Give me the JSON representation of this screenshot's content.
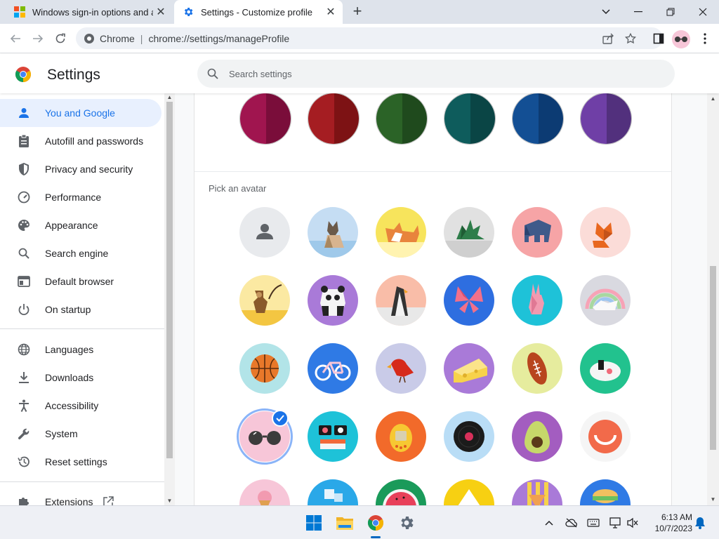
{
  "browser": {
    "tabs": [
      {
        "title": "Windows sign-in options and acc",
        "active": false
      },
      {
        "title": "Settings - Customize profile",
        "active": true
      }
    ],
    "omnibox": {
      "chip": "Chrome",
      "url": "chrome://settings/manageProfile"
    }
  },
  "settings": {
    "title": "Settings",
    "search_placeholder": "Search settings",
    "nav": [
      {
        "label": "You and Google",
        "icon": "person-icon",
        "active": true
      },
      {
        "label": "Autofill and passwords",
        "icon": "clipboard-icon"
      },
      {
        "label": "Privacy and security",
        "icon": "shield-icon"
      },
      {
        "label": "Performance",
        "icon": "speedometer-icon"
      },
      {
        "label": "Appearance",
        "icon": "palette-icon"
      },
      {
        "label": "Search engine",
        "icon": "search-icon"
      },
      {
        "label": "Default browser",
        "icon": "browser-window-icon"
      },
      {
        "label": "On startup",
        "icon": "power-icon"
      },
      {
        "label": "Languages",
        "icon": "globe-icon"
      },
      {
        "label": "Downloads",
        "icon": "download-icon"
      },
      {
        "label": "Accessibility",
        "icon": "accessibility-icon"
      },
      {
        "label": "System",
        "icon": "wrench-icon"
      },
      {
        "label": "Reset settings",
        "icon": "reset-history-icon"
      },
      {
        "label": "Extensions",
        "icon": "puzzle-icon"
      }
    ],
    "theme_colors": [
      {
        "left": "#a0154f",
        "right": "#7a0d3a"
      },
      {
        "left": "#a51d22",
        "right": "#7d1214"
      },
      {
        "left": "#2b6327",
        "right": "#1f4a1d"
      },
      {
        "left": "#0e5c5c",
        "right": "#0a4545"
      },
      {
        "left": "#134f94",
        "right": "#0c3b73"
      },
      {
        "left": "#6f3fa6",
        "right": "#52307d"
      }
    ],
    "avatar_section_label": "Pick an avatar",
    "avatars": [
      "generic-person-avatar",
      "origami-cat-avatar",
      "origami-corgi-avatar",
      "origami-dragon-avatar",
      "origami-elephant-avatar",
      "origami-fox-avatar",
      "origami-monkey-avatar",
      "origami-panda-avatar",
      "origami-penguin-avatar",
      "origami-butterfly-avatar",
      "origami-rabbit-avatar",
      "origami-unicorn-avatar",
      "basketball-avatar",
      "bicycle-avatar",
      "red-bird-avatar",
      "cheese-avatar",
      "football-avatar",
      "sushi-plate-avatar",
      "sunglasses-avatar",
      "sushi-rolls-avatar",
      "tamagotchi-avatar",
      "vinyl-record-avatar",
      "avocado-avatar",
      "smiley-face-avatar",
      "ice-cream-avatar",
      "ice-cubes-avatar",
      "watermelon-avatar",
      "onigiri-avatar",
      "pizza-slice-avatar",
      "sandwich-avatar"
    ],
    "selected_avatar": "sunglasses-avatar"
  },
  "taskbar": {
    "time": "6:13 AM",
    "date": "10/7/2023",
    "apps": [
      "start-icon",
      "file-explorer-icon",
      "chrome-icon",
      "settings-gear-icon"
    ]
  }
}
